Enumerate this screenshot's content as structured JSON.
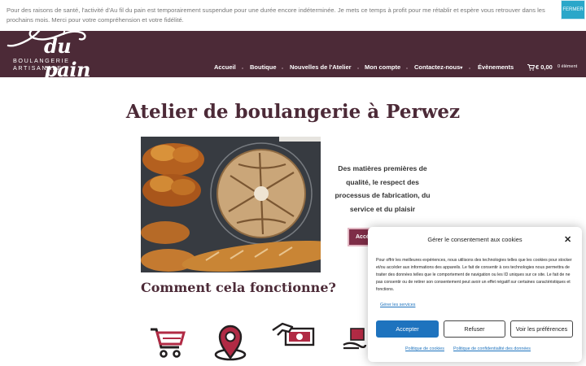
{
  "notice": {
    "text": "Pour des raisons de santé, l'activité d'Au fil du pain est temporairement suspendue pour une durée encore indéterminée. Je mets ce temps à profit pour me rétablir et espère vous retrouver dans les prochains mois. Merci pour votre compréhension et votre fidélité.",
    "close_label": "FERMER"
  },
  "header": {
    "logo_script": "du pain",
    "logo_subtitle": "BOULANGERIE ARTISANALE",
    "nav": [
      "Accueil",
      "Boutique",
      "Nouvelles de l'Atelier",
      "Mon compte",
      "Contactez-nous",
      "Évènements"
    ],
    "contact_caret": "▾",
    "cart_total": "€ 0,00",
    "cart_count": "0 élément"
  },
  "main": {
    "title": "Atelier de boulangerie à Perwez",
    "intro": "Des matières premières de qualité, le respect des processus de fabrication, du service et du plaisir",
    "cta_label": "Accéder",
    "section_title": "Comment cela fonctionne?"
  },
  "consent": {
    "title": "Gérer le consentement aux cookies",
    "body": "Pour offrir les meilleures expériences, nous utilisons des technologies telles que les cookies pour stocker et/ou accéder aux informations des appareils. Le fait de consentir à ces technologies nous permettra de traiter des données telles que le comportement de navigation ou les ID uniques sur ce site. Le fait de ne pas consentir ou de retirer son consentement peut avoir un effet négatif sur certaines caractéristiques et fonctions.",
    "manage_services": "Gérer les services",
    "accept_label": "Accepter",
    "refuse_label": "Refuser",
    "prefs_label": "Voir les préférences",
    "cookie_policy": "Politique de cookies",
    "privacy_policy": "Politique de confidentialité des données"
  },
  "colors": {
    "brand": "#4c2a37",
    "accent": "#7e2d47",
    "consent_primary": "#1e73be",
    "notice_close": "#2aa7c9"
  },
  "icons": [
    "shopping-cart-icon",
    "map-pin-icon",
    "banknote-hand-icon",
    "hand-bag-icon"
  ]
}
